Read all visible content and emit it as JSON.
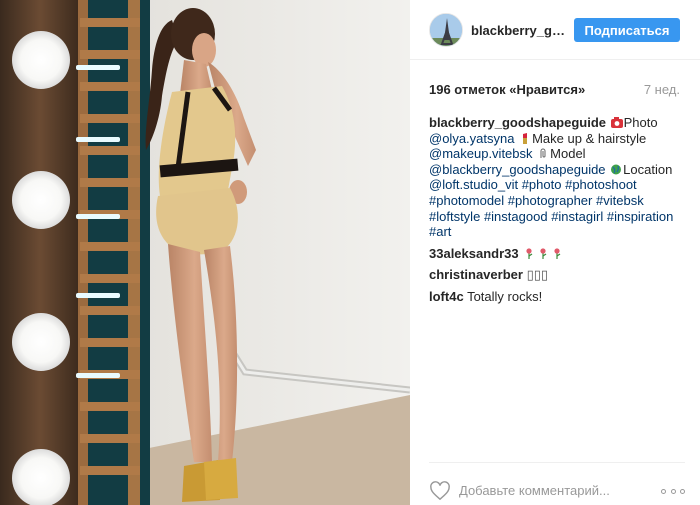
{
  "photo": {
    "icon": "photo-of-woman-in-studio"
  },
  "header": {
    "username": "blackberry_goodshapeguide",
    "follow_label": "Подписаться",
    "avatar_icon": "eiffel-tower-avatar"
  },
  "likes": {
    "count_text": "196 отметок «Нравится»",
    "time": "7 нед."
  },
  "caption": {
    "author": "blackberry_goodshapeguide",
    "line1_text": "Photo",
    "mention1": "@olya.yatsyna",
    "makeup_text": "Make up & hairstyle",
    "mention2": "@makeup.vitebsk",
    "model_text": "Model",
    "mention3": "@blackberry_goodshapeguide",
    "location_text": "Location",
    "mention4": "@loft.studio_vit",
    "tag1": "#photo",
    "tag2": "#photoshoot",
    "tag3": "#photomodel",
    "tag4": "#photographer",
    "tag5": "#vitebsk",
    "tag6": "#loftstyle",
    "tag7": "#instagood",
    "tag8": "#instagirl",
    "tag9": "#inspiration",
    "tag10": "#art"
  },
  "comments": [
    {
      "author": "33aleksandr33",
      "text": ""
    },
    {
      "author": "christinaverber",
      "text": "▯▯▯"
    },
    {
      "author": "loft4c",
      "text": "Totally rocks!"
    }
  ],
  "comment_box": {
    "placeholder": "Добавьте комментарий..."
  },
  "colors": {
    "accent": "#3897f0",
    "link": "#003569",
    "muted": "#999999"
  }
}
